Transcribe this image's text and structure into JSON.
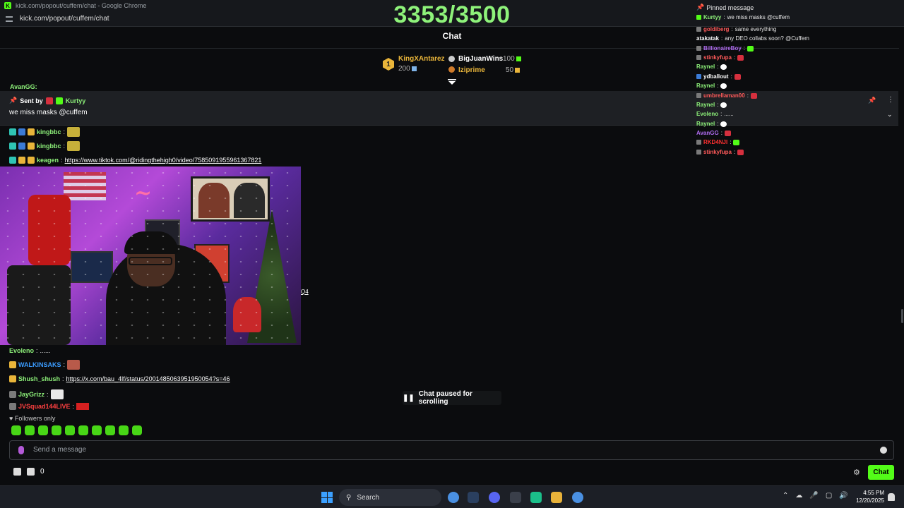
{
  "browser": {
    "window_title": "kick.com/popout/cuffem/chat - Google Chrome",
    "url": "kick.com/popout/cuffem/chat"
  },
  "overlay_counter": "3353/3500",
  "chat": {
    "title": "Chat",
    "leaderboard": {
      "first": {
        "rank": "1",
        "name": "KingXAntarez",
        "value": "200"
      },
      "second": {
        "name": "BigJuanWins",
        "value": "100"
      },
      "third": {
        "name": "Iziprime",
        "value": "50"
      }
    },
    "cut_line": "AvanGG:",
    "pinned": {
      "sent_by_label": "Sent by",
      "user": "Kurtyy",
      "message": "we miss masks @cuffem"
    },
    "messages": [
      {
        "user": "kingbbc",
        "text": "",
        "user_color": "#8ef27a"
      },
      {
        "user": "kingbbc",
        "text": "",
        "user_color": "#8ef27a"
      },
      {
        "user": "keagen",
        "text": "https://www.tiktok.com/@ridingthehigh0/video/7585091955961367821",
        "user_color": "#8ef27a"
      }
    ],
    "after_video_fragment": "Q4",
    "messages2": [
      {
        "user": "Evoleno",
        "text": "......",
        "user_color": "#8ef27a"
      },
      {
        "user": "WALKINSAKS",
        "text": "",
        "user_color": "#3b9cff"
      },
      {
        "user": "Shush_shush",
        "text": "https://x.com/bau_4lf/status/2001485063951950054?s=46",
        "user_color": "#8ef27a"
      },
      {
        "user": "JayGrizz",
        "text": "",
        "user_color": "#8ef27a"
      },
      {
        "user": "JVSquad144LIVE",
        "text": "",
        "user_color": "#ff4040"
      }
    ],
    "paused_label": "Chat paused for scrolling",
    "followers_label": "Followers only",
    "input_placeholder": "Send a message",
    "bottom_count": "0",
    "chat_button": "Chat"
  },
  "overlay_chat": {
    "pinned_label": "Pinned message",
    "pinned_line": {
      "user": "Kurtyy",
      "text": "we miss masks @cuffem"
    },
    "lines": [
      {
        "user": "goldiberg",
        "text": "same everything",
        "color": "#ff5a5a"
      },
      {
        "user": "atakatak",
        "text": "any DEO collabs soon? @Cuffem",
        "color": "#ffffff"
      },
      {
        "user": "BillionaireBoy",
        "text": "",
        "color": "#b06cf0"
      },
      {
        "user": "stinkyfupa",
        "text": "",
        "color": "#ff5a5a"
      },
      {
        "user": "Raynel",
        "text": "",
        "color": "#8ef27a"
      },
      {
        "user": "ydballout",
        "text": "",
        "color": "#ffffff"
      },
      {
        "user": "Raynel",
        "text": "",
        "color": "#8ef27a"
      },
      {
        "user": "umbrellaman00",
        "text": "",
        "color": "#ff5a5a"
      },
      {
        "user": "Raynel",
        "text": "",
        "color": "#8ef27a"
      },
      {
        "user": "Evoleno",
        "text": "......",
        "color": "#8ef27a"
      },
      {
        "user": "Raynel",
        "text": "",
        "color": "#8ef27a"
      },
      {
        "user": "AvanGG",
        "text": "",
        "color": "#b06cf0"
      },
      {
        "user": "RKD4NJI",
        "text": "",
        "color": "#ff3030"
      },
      {
        "user": "stinkyfupa",
        "text": "",
        "color": "#ff5a5a"
      }
    ]
  },
  "taskbar": {
    "search_label": "Search",
    "time": "4:55 PM",
    "date": "12/20/2025"
  }
}
